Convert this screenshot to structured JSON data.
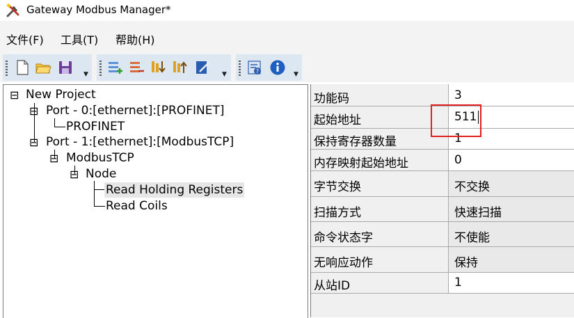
{
  "window": {
    "title": "Gateway Modbus Manager*"
  },
  "menu": [
    {
      "label": "文件(F)"
    },
    {
      "label": "工具(T)"
    },
    {
      "label": "帮助(H)"
    }
  ],
  "toolbar": {
    "groups": [
      [
        "new-file-icon",
        "open-folder-icon",
        "save-icon"
      ],
      [
        "add-item-icon",
        "remove-item-icon",
        "move-down-icon",
        "move-up-icon",
        "edit-note-icon"
      ],
      [
        "config-icon",
        "info-icon"
      ]
    ]
  },
  "tree": {
    "nodes": [
      {
        "label": "New Project"
      },
      {
        "label": "Port - 0:[ethernet]:[PROFINET]"
      },
      {
        "label": "PROFINET"
      },
      {
        "label": "Port - 1:[ethernet]:[ModbusTCP]"
      },
      {
        "label": "ModbusTCP"
      },
      {
        "label": "Node"
      },
      {
        "label": "Read Holding Registers",
        "selected": true
      },
      {
        "label": "Read Coils"
      }
    ]
  },
  "properties": [
    {
      "name": "功能码",
      "value": "3"
    },
    {
      "name": "起始地址",
      "value": "511"
    },
    {
      "name": "保持寄存器数量",
      "value": "1"
    },
    {
      "name": "内存映射起始地址",
      "value": "0"
    },
    {
      "name": "字节交换",
      "value": "不交换"
    },
    {
      "name": "扫描方式",
      "value": "快速扫描"
    },
    {
      "name": "命令状态字",
      "value": "不使能"
    },
    {
      "name": "无响应动作",
      "value": "保持"
    },
    {
      "name": "从站ID",
      "value": "1"
    }
  ],
  "colors": {
    "highlight": "#e02020",
    "selected_row": "#e6e6e6",
    "toolbar_group": "#dde7f2"
  }
}
